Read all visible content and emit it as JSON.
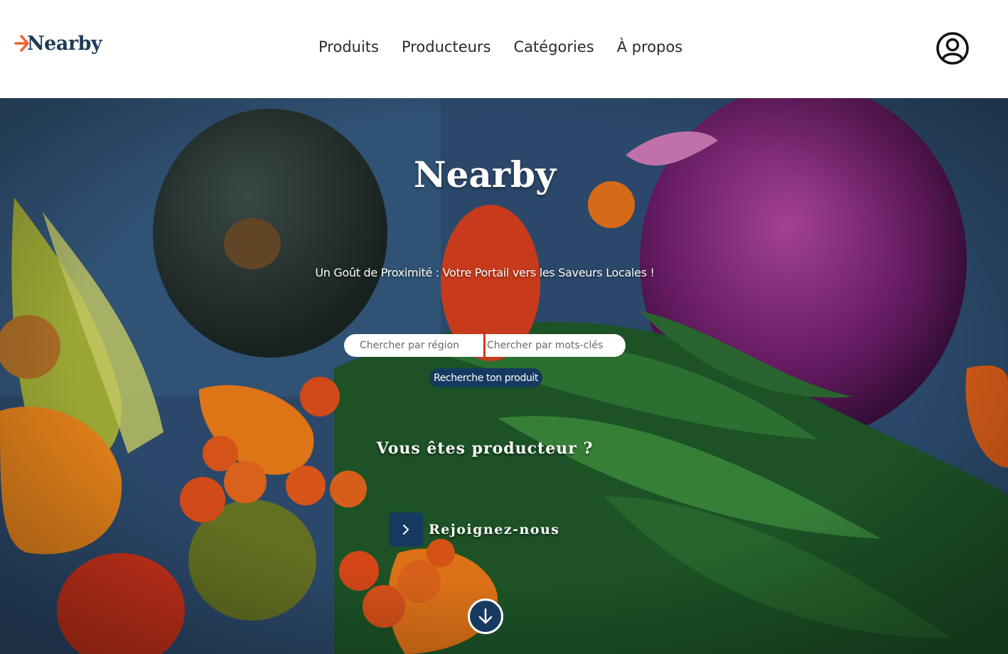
{
  "header": {
    "logo_text": "Nearby",
    "nav": [
      {
        "label": "Produits"
      },
      {
        "label": "Producteurs"
      },
      {
        "label": "Catégories"
      },
      {
        "label": "À propos"
      }
    ],
    "account_icon": "user-circle-icon"
  },
  "hero": {
    "title": "Nearby",
    "subtitle": "Un Goût de Proximité : Votre Portail vers les Saveurs Locales !",
    "search": {
      "region_placeholder": "Chercher par région",
      "keywords_placeholder": "Chercher par mots-clés",
      "button_label": "Recherche ton produit"
    },
    "producer": {
      "title": "Vous êtes producteur ?",
      "join_label": "Rejoignez-nous",
      "join_icon": "chevron-right-icon"
    },
    "scroll_icon": "arrow-down-circle-icon"
  },
  "colors": {
    "brand_navy": "#163a5f",
    "logo_arrow": "#f0602a",
    "logo_text": "#1f3b57"
  }
}
